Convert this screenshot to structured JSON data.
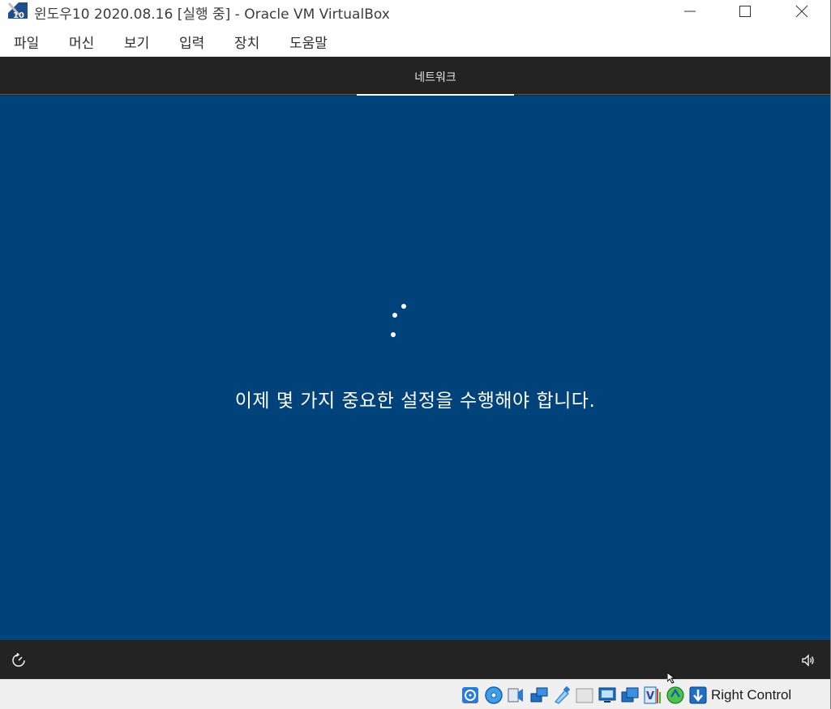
{
  "window": {
    "title": "윈도우10 2020.08.16 [실행 중] - Oracle VM VirtualBox",
    "app_icon": "virtualbox-vm-icon",
    "controls": [
      "minimize-icon",
      "maximize-icon",
      "close-icon"
    ]
  },
  "menu": {
    "items": [
      "파일",
      "머신",
      "보기",
      "입력",
      "장치",
      "도움말"
    ]
  },
  "guest": {
    "top_tab": "네트워크",
    "message": "이제 몇 가지 중요한 설정을 수행해야 합니다.",
    "background_color": "#00427a",
    "bar_color": "#232323",
    "bottom_left_icon": "ease-of-access-icon",
    "bottom_right_icon": "volume-icon"
  },
  "statusbar": {
    "icons": [
      "hard-disk-icon",
      "optical-drive-icon",
      "audio-icon",
      "network-icon",
      "usb-icon",
      "shared-folders-icon",
      "display-icon",
      "video-capture-icon",
      "virtualization-icon",
      "cpu-activity-icon",
      "mouse-integration-icon",
      "keyboard-capture-icon"
    ],
    "host_key": "Right Control"
  }
}
